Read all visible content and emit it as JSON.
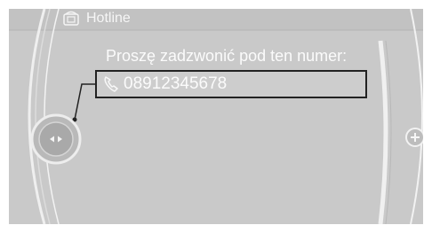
{
  "header": {
    "title": "Hotline",
    "icon": "hotline-icon"
  },
  "main": {
    "prompt": "Proszę zadzwonić pod ten numer:",
    "phone_number": "08912345678",
    "phone_icon": "phone-handset-icon"
  },
  "controls": {
    "controller_icon": "controller-knob-icon",
    "plus_icon": "plus-icon"
  },
  "colors": {
    "background": "#c9c9c9",
    "text": "#fbfbfb",
    "highlight_border": "#222222"
  }
}
